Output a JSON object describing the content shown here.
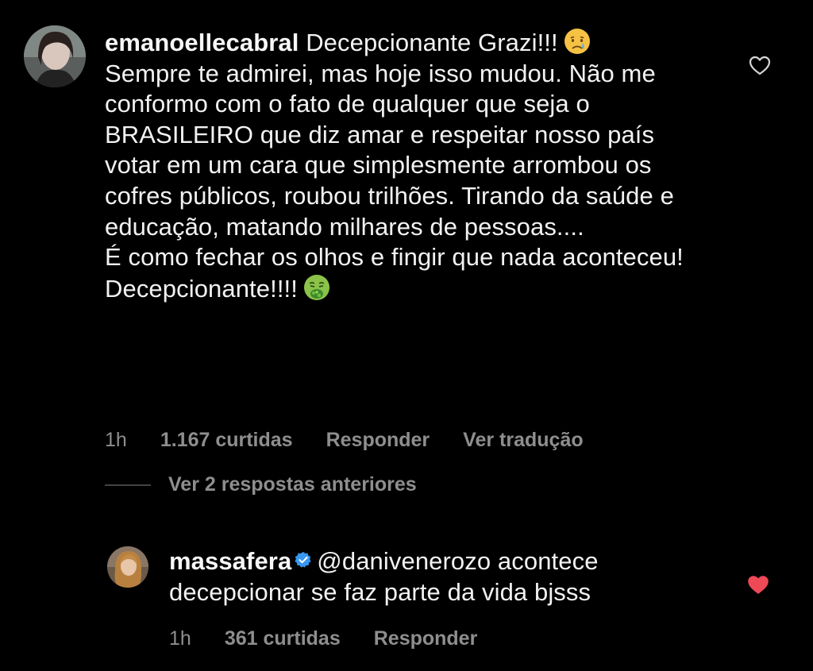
{
  "comment": {
    "username": "emanoellecabral",
    "first_text": "Decepcionante Grazi!!!",
    "first_emoji": "crying-face",
    "paragraphs": [
      "Sempre te admirei, mas hoje isso mudou. Não me conformo com o fato de qualquer que seja o BRASILEIRO que diz amar e respeitar nosso país votar em um cara que simplesmente arrombou os cofres públicos, roubou trilhões. Tirando da saúde e educação, matando milhares de pessoas....",
      "É como fechar os olhos e fingir que nada aconteceu!",
      "Decepcionante!!!!"
    ],
    "last_emoji": "nauseated-face",
    "time": "1h",
    "likes": "1.167 curtidas",
    "reply_label": "Responder",
    "translate_label": "Ver tradução",
    "liked": false
  },
  "view_replies": {
    "label": "Ver 2 respostas anteriores"
  },
  "reply": {
    "username": "massafera",
    "verified": true,
    "mention": "@danivenerozo",
    "text": "acontece decepcionar se faz parte da vida bjsss",
    "time": "1h",
    "likes": "361 curtidas",
    "reply_label": "Responder",
    "liked": true,
    "liked_color": "#ed4956"
  },
  "colors": {
    "background": "#000000",
    "text": "#f2f2f2",
    "secondary": "#8e8e8e",
    "verified": "#3897f0"
  }
}
